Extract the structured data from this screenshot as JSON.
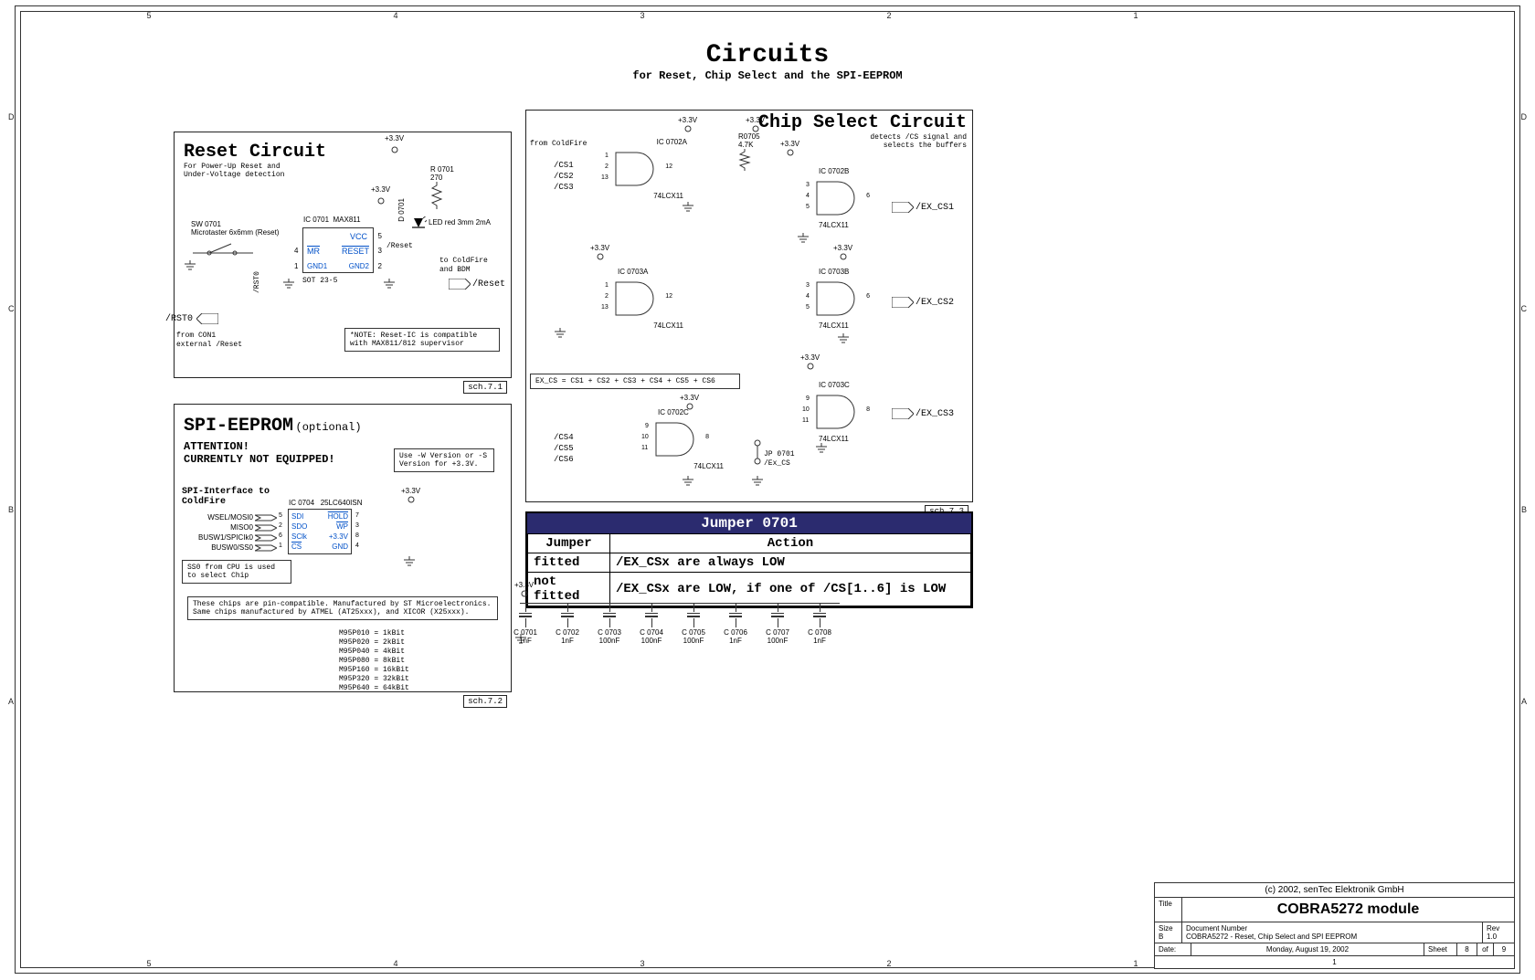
{
  "page": {
    "title": "Circuits",
    "subtitle": "for Reset, Chip Select and the SPI-EEPROM"
  },
  "frame": {
    "cols": [
      "5",
      "4",
      "3",
      "2",
      "1"
    ],
    "rows": [
      "D",
      "C",
      "B",
      "A"
    ]
  },
  "reset": {
    "heading": "Reset Circuit",
    "sub1": "For Power-Up Reset and",
    "sub2": "Under-Voltage detection",
    "sw_ref": "SW 0701",
    "sw_desc": "Microtaster 6x6mm (Reset)",
    "ic_ref": "IC 0701",
    "ic_part": "MAX811",
    "ic_pins": {
      "vcc": "VCC",
      "mr": "MR",
      "reset": "RESET",
      "gnd1": "GND1",
      "gnd2": "GND2"
    },
    "ic_pkg": "SOT 23-5",
    "r_ref": "R 0701",
    "r_val": "270",
    "d_ref": "D 0701",
    "led_desc": "LED red 3mm 2mA",
    "out1": "to ColdFire",
    "out2": "and BDM",
    "out_net": "/Reset",
    "in_net_top": "/Reset",
    "rst0_vert": "/RST0",
    "rst0_port": "/RST0",
    "note_src1": "from CON1",
    "note_src2": "external /Reset",
    "note_compat": "*NOTE: Reset-IC is compatible with MAX811/812 supervisor",
    "vcc1": "+3.3V",
    "vcc2": "+3.3V",
    "sch": "sch.7.1"
  },
  "eeprom": {
    "heading": "SPI-EEPROM",
    "opt": "(optional)",
    "attn": "ATTENTION!",
    "neq": "CURRENTLY NOT EQUIPPED!",
    "vernote": "Use -W Version or -S Version for +3.3V.",
    "iface1": "SPI-Interface to",
    "iface2": "ColdFire",
    "ic_ref": "IC 0704",
    "ic_part": "25LC640ISN",
    "nets_left": [
      "WSEL/MOSI0",
      "MISO0",
      "BUSW1/SPICIk0",
      "BUSW0/SS0"
    ],
    "pins_left_no": [
      "5",
      "2",
      "6",
      "1"
    ],
    "pins_left": [
      "SDI",
      "SDO",
      "SClk",
      "CS"
    ],
    "pins_right": [
      "HOLD",
      "WP",
      "+3.3V",
      "GND"
    ],
    "pins_right_no": [
      "7",
      "3",
      "8",
      "4"
    ],
    "vcc": "+3.3V",
    "note_sel1": "SS0 from CPU is used",
    "note_sel2": "to select Chip",
    "compat1": "These chips are pin-compatible. Manufactured by ST Microelectronics.",
    "compat2": "Same chips manufactured by ATMEL (AT25xxx), and XICOR (X25xxx).",
    "parts": [
      "M95P010 = 1kBit",
      "M95P020 = 2kBit",
      "M95P040 = 4kBit",
      "M95P080 = 8kBit",
      "M95P160 = 16kBit",
      "M95P320 = 32kBit",
      "M95P640 = 64kBit"
    ],
    "sch": "sch.7.2"
  },
  "chipsel": {
    "heading": "Chip Select Circuit",
    "sub1": "detects /CS signal and",
    "sub2": "selects the buffers",
    "from": "from ColdFire",
    "vcc": "+3.3V",
    "r_ref": "R0705",
    "r_val": "4.7K",
    "ics": [
      {
        "ref": "IC 0702A",
        "part": "74LCX11",
        "pins_in": [
          "1",
          "2",
          "13"
        ],
        "pin_out": "12"
      },
      {
        "ref": "IC 0703A",
        "part": "74LCX11",
        "pins_in": [
          "1",
          "2",
          "13"
        ],
        "pin_out": "12"
      },
      {
        "ref": "IC 0702C",
        "part": "74LCX11",
        "pins_in": [
          "9",
          "10",
          "11"
        ],
        "pin_out": "8"
      },
      {
        "ref": "IC 0702B",
        "part": "74LCX11",
        "pins_in": [
          "3",
          "4",
          "5"
        ],
        "pin_out": "6"
      },
      {
        "ref": "IC 0703B",
        "part": "74LCX11",
        "pins_in": [
          "3",
          "4",
          "5"
        ],
        "pin_out": "6"
      },
      {
        "ref": "IC 0703C",
        "part": "74LCX11",
        "pins_in": [
          "9",
          "10",
          "11"
        ],
        "pin_out": "8"
      }
    ],
    "in_nets_a": [
      "/CS1",
      "/CS2",
      "/CS3"
    ],
    "in_nets_b": [
      "/CS4",
      "/CS5",
      "/CS6"
    ],
    "out_nets": [
      "/EX_CS1",
      "/EX_CS2",
      "/EX_CS3"
    ],
    "jp_ref": "JP 0701",
    "jp_net": "/Ex_CS",
    "eq_note": "EX_CS = CS1 + CS2 + CS3 + CS4 + CS5 + CS6",
    "sch": "sch.7.3"
  },
  "jumper_table": {
    "title": "Jumper 0701",
    "col1": "Jumper",
    "col2": "Action",
    "rows": [
      {
        "j": "fitted",
        "a": "/EX_CSx are always LOW"
      },
      {
        "j": "not fitted",
        "a": "/EX_CSx are LOW, if one of /CS[1..6] is LOW"
      }
    ]
  },
  "caps": {
    "vcc": "+3.3V",
    "items": [
      {
        "ref": "C 0701",
        "val": "1nF"
      },
      {
        "ref": "C 0702",
        "val": "1nF"
      },
      {
        "ref": "C 0703",
        "val": "100nF"
      },
      {
        "ref": "C 0704",
        "val": "100nF"
      },
      {
        "ref": "C 0705",
        "val": "100nF"
      },
      {
        "ref": "C 0706",
        "val": "1nF"
      },
      {
        "ref": "C 0707",
        "val": "100nF"
      },
      {
        "ref": "C 0708",
        "val": "1nF"
      }
    ]
  },
  "title_block": {
    "copyright": "(c) 2002, senTec Elektronik GmbH",
    "title_lbl": "Title",
    "title": "COBRA5272 module",
    "size_lbl": "Size",
    "size": "B",
    "docnum_lbl": "Document Number",
    "docnum": "COBRA5272 - Reset, Chip Select and SPI EEPROM",
    "rev_lbl": "Rev",
    "rev": "1.0",
    "date_lbl": "Date:",
    "date": "Monday, August 19, 2002",
    "sheet_lbl": "Sheet",
    "sheet_n": "8",
    "of": "of",
    "sheet_tot": "9",
    "footer_one": "1"
  }
}
